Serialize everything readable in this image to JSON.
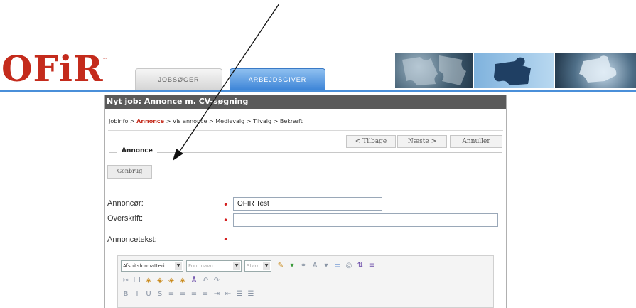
{
  "header": {
    "logo": "OFiR",
    "logo_mark": "™",
    "tabs": [
      {
        "label": "JOBSØGER",
        "active": false
      },
      {
        "label": "ARBEJDSGIVER",
        "active": true
      }
    ]
  },
  "panel": {
    "title": "Nyt job: Annonce m. CV-søgning",
    "breadcrumb": {
      "first": "Jobinfo",
      "active": "Annonce",
      "rest": "Vis annonce > Medievalg > Tilvalg > Bekræft",
      "sep": ">"
    },
    "buttons": {
      "back": "< Tilbage",
      "next": "Næste >",
      "cancel": "Annuller",
      "reuse": "Genbrug"
    },
    "section_title": "Annonce",
    "fields": {
      "advertiser_label": "Annoncør:",
      "advertiser_value": "OFIR Test",
      "headline_label": "Overskrift:",
      "headline_value": "",
      "adtext_label": "Annoncetekst:"
    },
    "editor": {
      "format_select": "Afsnitsformatteri",
      "font_select": "Font navn",
      "size_select": "Størr"
    }
  },
  "colors": {
    "brand_red": "#c42b1c",
    "tab_blue": "#4a8fd9",
    "title_bar": "#5a5a5a",
    "required": "#d42020"
  },
  "icons": [
    "puzzle-image",
    "undo-icon",
    "redo-icon",
    "bold-icon",
    "italic-icon",
    "underline-icon",
    "strikethrough-icon",
    "align-left-icon",
    "align-center-icon",
    "align-right-icon",
    "justify-icon",
    "indent-icon",
    "outdent-icon",
    "bullet-list-icon",
    "numbered-list-icon",
    "text-color-icon",
    "highlight-icon",
    "table-icon",
    "image-icon",
    "link-icon"
  ]
}
